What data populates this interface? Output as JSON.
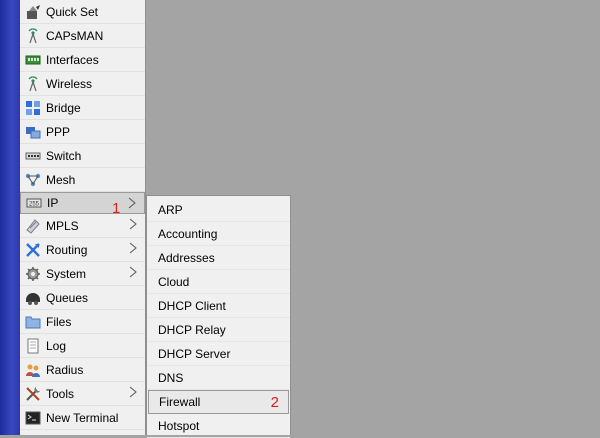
{
  "main_menu": {
    "items": [
      {
        "label": "Quick Set",
        "icon": "quick-set-icon"
      },
      {
        "label": "CAPsMAN",
        "icon": "antenna-icon"
      },
      {
        "label": "Interfaces",
        "icon": "interfaces-icon"
      },
      {
        "label": "Wireless",
        "icon": "antenna-icon"
      },
      {
        "label": "Bridge",
        "icon": "bridge-icon"
      },
      {
        "label": "PPP",
        "icon": "ppp-icon"
      },
      {
        "label": "Switch",
        "icon": "switch-icon"
      },
      {
        "label": "Mesh",
        "icon": "mesh-icon"
      },
      {
        "label": "IP",
        "icon": "ip-icon",
        "has_submenu": true,
        "active": true
      },
      {
        "label": "MPLS",
        "icon": "mpls-icon",
        "has_submenu": true
      },
      {
        "label": "Routing",
        "icon": "routing-icon",
        "has_submenu": true
      },
      {
        "label": "System",
        "icon": "gear-icon",
        "has_submenu": true
      },
      {
        "label": "Queues",
        "icon": "queues-icon"
      },
      {
        "label": "Files",
        "icon": "folder-icon"
      },
      {
        "label": "Log",
        "icon": "log-icon"
      },
      {
        "label": "Radius",
        "icon": "users-icon"
      },
      {
        "label": "Tools",
        "icon": "tools-icon",
        "has_submenu": true
      },
      {
        "label": "New Terminal",
        "icon": "terminal-icon"
      }
    ]
  },
  "ip_submenu": {
    "items": [
      {
        "label": "ARP"
      },
      {
        "label": "Accounting"
      },
      {
        "label": "Addresses"
      },
      {
        "label": "Cloud"
      },
      {
        "label": "DHCP Client"
      },
      {
        "label": "DHCP Relay"
      },
      {
        "label": "DHCP Server"
      },
      {
        "label": "DNS"
      },
      {
        "label": "Firewall",
        "active": true
      },
      {
        "label": "Hotspot"
      }
    ]
  },
  "annotations": {
    "step1": "1",
    "step2": "2"
  },
  "colors": {
    "background": "#a4a4a4",
    "menu_background": "#f0f0f0",
    "strip": "#2b39a8",
    "annotation": "#e11b1b"
  }
}
